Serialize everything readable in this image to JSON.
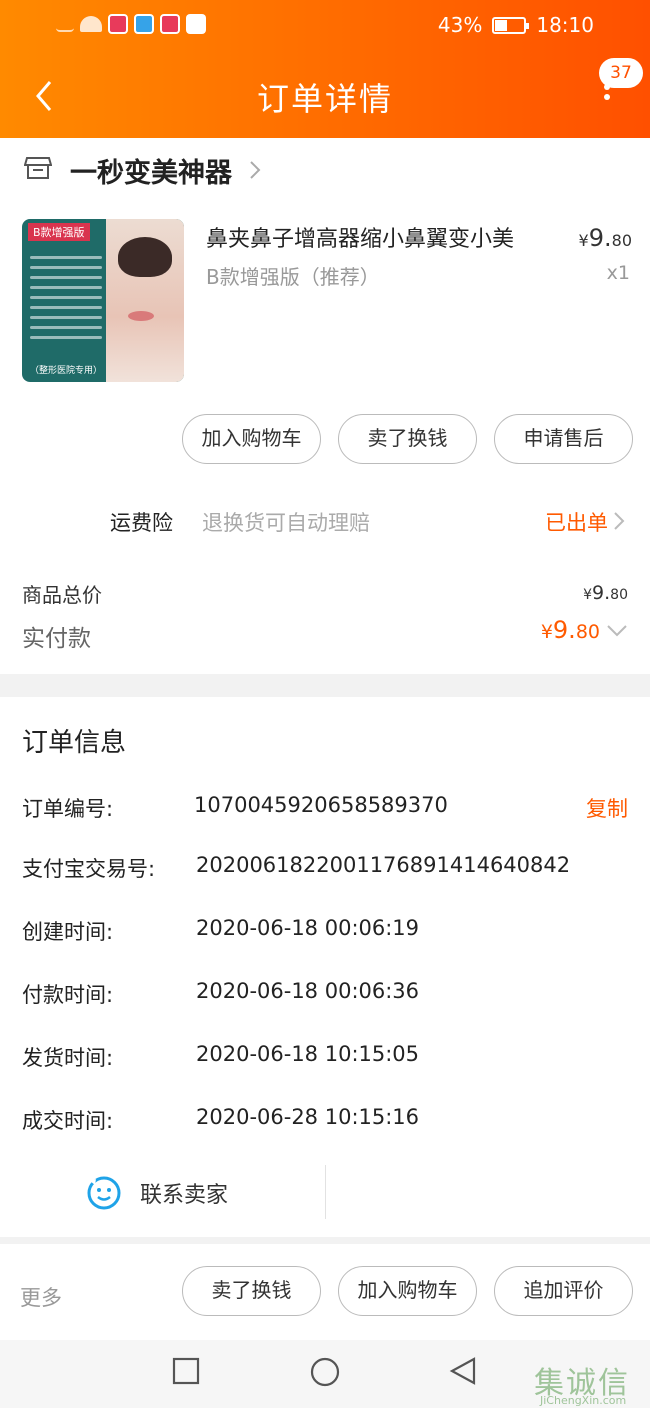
{
  "status_bar": {
    "battery_text": "43%",
    "battery_level": 0.43,
    "time": "18:10"
  },
  "header": {
    "title": "订单详情",
    "notification_count": "37"
  },
  "shop": {
    "name": "一秒变美神器"
  },
  "product": {
    "image_tag": "B款增强版",
    "image_footer": "（整形医院专用）",
    "title": "鼻夹鼻子增高器缩小鼻翼变小美",
    "spec": "B款增强版（推荐）",
    "price_currency": "¥",
    "price_int": "9.",
    "price_dec": "80",
    "quantity": "x1"
  },
  "product_actions": [
    "加入购物车",
    "卖了换钱",
    "申请售后"
  ],
  "insurance": {
    "label": "运费险",
    "description": "退换货可自动理赔",
    "status": "已出单"
  },
  "summary": {
    "goods_total_label": "商品总价",
    "goods_total_currency": "¥",
    "goods_total_int": "9.",
    "goods_total_dec": "80",
    "paid_label": "实付款",
    "paid_currency": "¥",
    "paid_int": "9.",
    "paid_dec": "80"
  },
  "order_info": {
    "title": "订单信息",
    "copy_label": "复制",
    "rows": [
      {
        "label": "订单编号:",
        "value": "1070045920658589370"
      },
      {
        "label": "支付宝交易号:",
        "value": "2020061822001176891414640842"
      },
      {
        "label": "创建时间:",
        "value": "2020-06-18 00:06:19"
      },
      {
        "label": "付款时间:",
        "value": "2020-06-18 00:06:36"
      },
      {
        "label": "发货时间:",
        "value": "2020-06-18 10:15:05"
      },
      {
        "label": "成交时间:",
        "value": "2020-06-28 10:15:16"
      }
    ],
    "contact_label": "联系卖家"
  },
  "bottom_bar": {
    "more_label": "更多",
    "buttons": [
      "卖了换钱",
      "加入购物车",
      "追加评价"
    ]
  },
  "watermark": {
    "text": "集诚信",
    "sub": "JiChengXin.com"
  },
  "colors": {
    "accent": "#ff5000",
    "header_start": "#ff8a00",
    "price": "#ff5a00"
  }
}
